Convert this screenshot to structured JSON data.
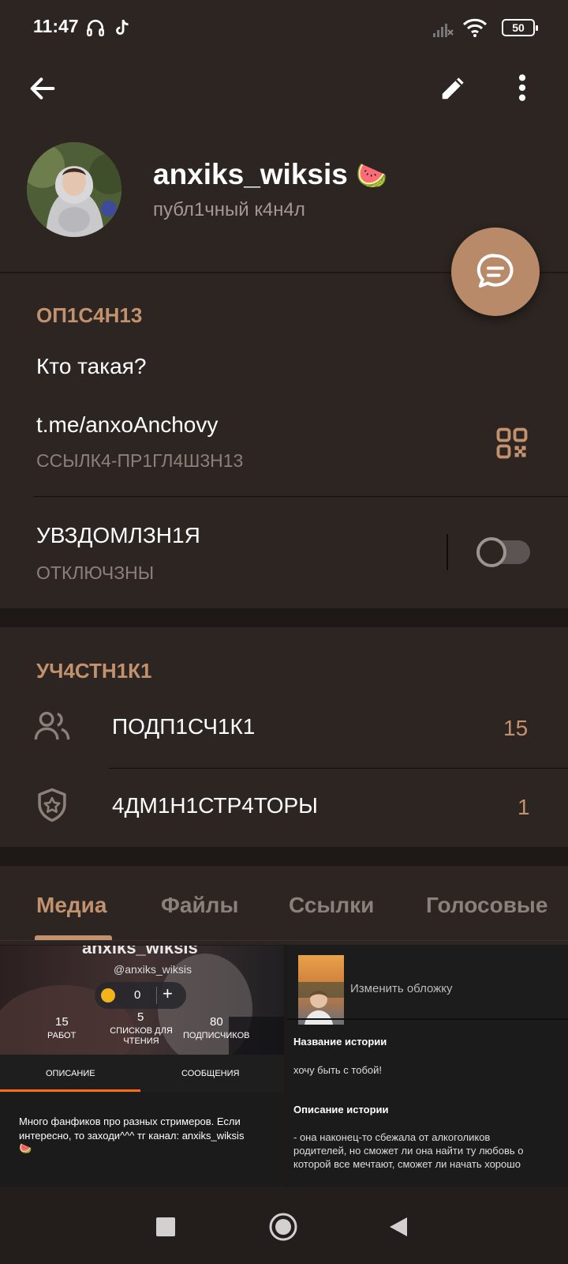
{
  "status_bar": {
    "time": "11:47",
    "battery": "50",
    "icons": [
      "headphones-icon",
      "tiktok-icon",
      "signal-icon",
      "wifi-icon",
      "battery-icon"
    ]
  },
  "toolbar": {
    "icons": [
      "back-arrow-icon",
      "edit-pencil-icon",
      "more-vertical-icon"
    ]
  },
  "channel": {
    "name": "anxiks_wiksis",
    "emoji": "🍉",
    "type": "публ1чный к4н4л"
  },
  "description": {
    "section_title": "ОП1С4Н13",
    "text": "Кто такая?",
    "link": "t.me/anxoAnchovy",
    "link_caption": "ССЫЛК4-ПР1ГЛ4Ш3Н13"
  },
  "notifications": {
    "label": "УВЗДОМЛЗН1Я",
    "status": "ОТКЛЮЧЗНЫ",
    "enabled": false
  },
  "members": {
    "section_title": "УЧ4СТН1К1",
    "subscribers_label": "ПОДП1СЧ1К1",
    "subscribers_count": "15",
    "admins_label": "4ДМ1Н1СТР4ТОРЫ",
    "admins_count": "1"
  },
  "tabs": [
    {
      "label": "Медиа",
      "active": true
    },
    {
      "label": "Файлы",
      "active": false
    },
    {
      "label": "Ссылки",
      "active": false
    },
    {
      "label": "Голосовые",
      "active": false
    }
  ],
  "media_left": {
    "name": "anxiks_wiksis",
    "handle": "@anxiks_wiksis",
    "coins": "0",
    "plus": "+",
    "stats": [
      {
        "value": "15",
        "label": "РАБОТ"
      },
      {
        "value": "5",
        "label": "СПИСКОВ ДЛЯ ЧТЕНИЯ"
      },
      {
        "value": "80",
        "label": "ПОДПИСЧИКОВ"
      }
    ],
    "tab_description": "ОПИСАНИЕ",
    "tab_messages": "СООБЩЕНИЯ",
    "bio": "Много фанфиков про разных стримеров. Если интересно, то заходи^^^ тг канал: anxiks_wiksis",
    "bio_emoji": "🍉"
  },
  "media_right": {
    "change_cover": "Изменить обложку",
    "story_title_label": "Название истории",
    "story_title": "хочу быть с тобой!",
    "story_desc_label": "Описание истории",
    "story_desc": "- она наконец-то сбежала от алкоголиков родителей, но сможет ли она найти ту любовь о которой все мечтают, сможет ли начать хорошо"
  },
  "colors": {
    "accent": "#c2916e",
    "background": "#1e1917",
    "card": "#2c2522",
    "fab": "#b88a6a"
  }
}
